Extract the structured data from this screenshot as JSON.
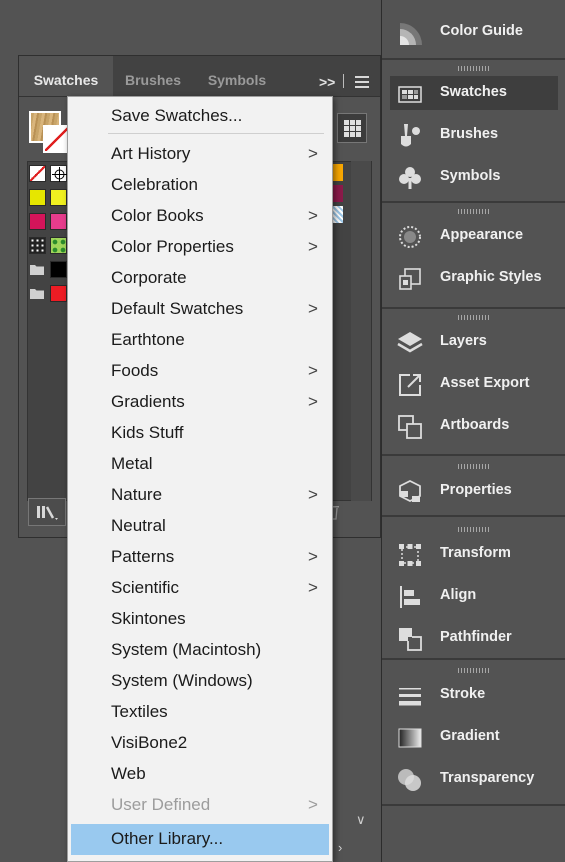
{
  "panel": {
    "tabs": [
      "Swatches",
      "Brushes",
      "Symbols"
    ],
    "overflow_glyph": ">>",
    "swatch_rows": [
      [
        "none",
        "registration"
      ],
      [
        "#e6e600",
        "#f0f020"
      ],
      [
        "#d4145a",
        "#e63c8c"
      ],
      [
        "pattern-dots",
        "pattern-leaf"
      ],
      [
        "folder",
        "#000000"
      ],
      [
        "folder",
        "#ed1c24"
      ]
    ],
    "right_swatches": [
      "#f7a600",
      "#8b1a4a",
      "pattern-blue"
    ]
  },
  "menu": {
    "items": [
      {
        "label": "Save Swatches...",
        "submenu": false,
        "state": "normal"
      },
      {
        "label": "Art History",
        "submenu": true,
        "state": "normal"
      },
      {
        "label": "Celebration",
        "submenu": false,
        "state": "normal"
      },
      {
        "label": "Color Books",
        "submenu": true,
        "state": "normal"
      },
      {
        "label": "Color Properties",
        "submenu": true,
        "state": "normal"
      },
      {
        "label": "Corporate",
        "submenu": false,
        "state": "normal"
      },
      {
        "label": "Default Swatches",
        "submenu": true,
        "state": "normal"
      },
      {
        "label": "Earthtone",
        "submenu": false,
        "state": "normal"
      },
      {
        "label": "Foods",
        "submenu": true,
        "state": "normal"
      },
      {
        "label": "Gradients",
        "submenu": true,
        "state": "normal"
      },
      {
        "label": "Kids Stuff",
        "submenu": false,
        "state": "normal"
      },
      {
        "label": "Metal",
        "submenu": false,
        "state": "normal"
      },
      {
        "label": "Nature",
        "submenu": true,
        "state": "normal"
      },
      {
        "label": "Neutral",
        "submenu": false,
        "state": "normal"
      },
      {
        "label": "Patterns",
        "submenu": true,
        "state": "normal"
      },
      {
        "label": "Scientific",
        "submenu": true,
        "state": "normal"
      },
      {
        "label": "Skintones",
        "submenu": false,
        "state": "normal"
      },
      {
        "label": "System (Macintosh)",
        "submenu": false,
        "state": "normal"
      },
      {
        "label": "System (Windows)",
        "submenu": false,
        "state": "normal"
      },
      {
        "label": "Textiles",
        "submenu": false,
        "state": "normal"
      },
      {
        "label": "VisiBone2",
        "submenu": false,
        "state": "normal"
      },
      {
        "label": "Web",
        "submenu": false,
        "state": "normal"
      },
      {
        "label": "User Defined",
        "submenu": true,
        "state": "disabled"
      },
      {
        "label": "Other Library...",
        "submenu": false,
        "state": "highlighted"
      }
    ],
    "submenu_glyph": ">"
  },
  "dock": {
    "groups": [
      {
        "items": [
          {
            "label": "Color Guide",
            "icon": "color-guide-icon"
          }
        ]
      },
      {
        "items": [
          {
            "label": "Swatches",
            "icon": "swatches-icon",
            "active": true
          },
          {
            "label": "Brushes",
            "icon": "brushes-icon"
          },
          {
            "label": "Symbols",
            "icon": "symbols-icon"
          }
        ]
      },
      {
        "items": [
          {
            "label": "Appearance",
            "icon": "appearance-icon"
          },
          {
            "label": "Graphic Styles",
            "icon": "graphic-styles-icon"
          }
        ]
      },
      {
        "items": [
          {
            "label": "Layers",
            "icon": "layers-icon"
          },
          {
            "label": "Asset Export",
            "icon": "asset-export-icon"
          },
          {
            "label": "Artboards",
            "icon": "artboards-icon"
          }
        ]
      },
      {
        "items": [
          {
            "label": "Properties",
            "icon": "properties-icon"
          }
        ]
      },
      {
        "items": [
          {
            "label": "Transform",
            "icon": "transform-icon"
          },
          {
            "label": "Align",
            "icon": "align-icon"
          },
          {
            "label": "Pathfinder",
            "icon": "pathfinder-icon"
          }
        ]
      },
      {
        "items": [
          {
            "label": "Stroke",
            "icon": "stroke-icon"
          },
          {
            "label": "Gradient",
            "icon": "gradient-icon"
          },
          {
            "label": "Transparency",
            "icon": "transparency-icon"
          }
        ]
      }
    ]
  },
  "colors": {
    "highlight": "#99c9ef",
    "menu_bg": "#f2f2f2",
    "app_bg": "#535353"
  }
}
